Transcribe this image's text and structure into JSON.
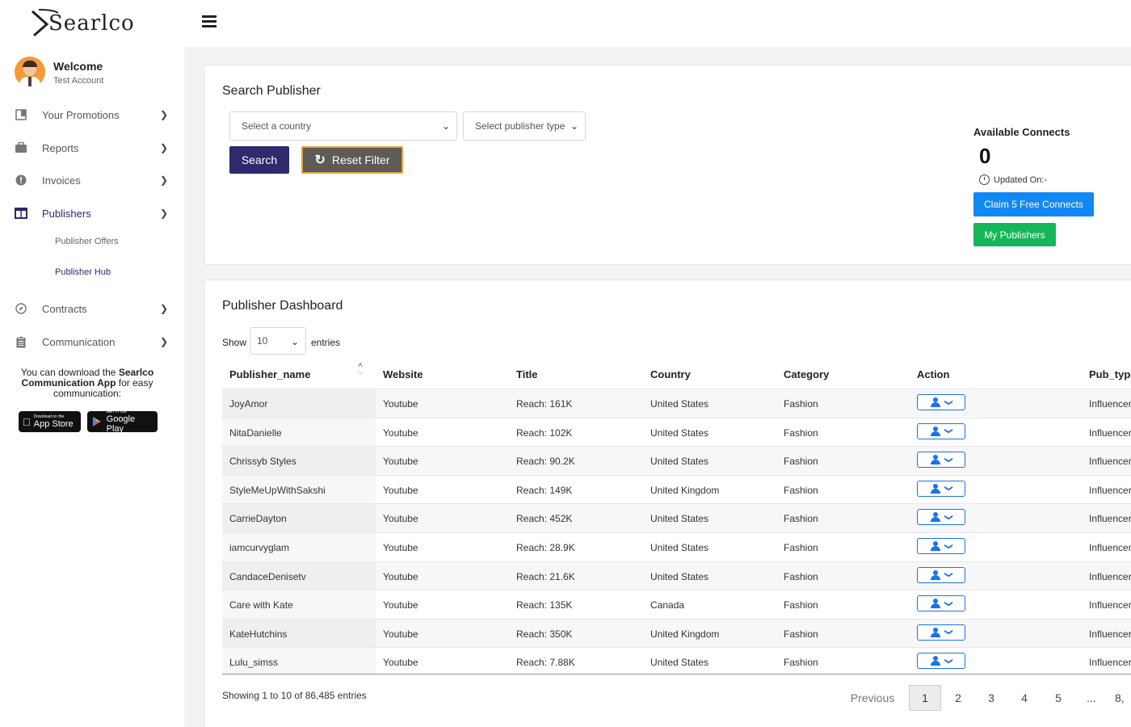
{
  "app": {
    "logo_text": "Searlco"
  },
  "profile": {
    "welcome": "Welcome",
    "account": "Test Account"
  },
  "sidebar": {
    "items": [
      {
        "label": "Your Promotions",
        "icon": "promotions-icon"
      },
      {
        "label": "Reports",
        "icon": "briefcase-icon"
      },
      {
        "label": "Invoices",
        "icon": "alert-circle-icon"
      },
      {
        "label": "Publishers",
        "icon": "columns-icon"
      },
      {
        "label": "Contracts",
        "icon": "compass-icon"
      },
      {
        "label": "Communication",
        "icon": "clipboard-icon"
      }
    ],
    "sub_items": [
      {
        "label": "Publisher Offers"
      },
      {
        "label": "Publisher Hub"
      }
    ],
    "download_pre": "You can download the ",
    "download_bold": "Searlco Communication App",
    "download_post": " for easy communication:",
    "app_store": {
      "small": "Download on the",
      "big": "App Store"
    },
    "google_play": {
      "small": "GET IT ON",
      "big": "Google Play"
    }
  },
  "search": {
    "title": "Search Publisher",
    "country_placeholder": "Select a country",
    "type_placeholder": "Select publisher type",
    "search_label": "Search",
    "reset_label": "Reset Filter"
  },
  "connects": {
    "title": "Available Connects",
    "count": "0",
    "updated": "Updated On:-",
    "claim_label": "Claim 5 Free Connects",
    "my_publishers_label": "My Publishers"
  },
  "dashboard": {
    "title": "Publisher Dashboard",
    "show": "Show",
    "entries_value": "10",
    "entries": "entries",
    "columns": [
      "Publisher_name",
      "Website",
      "Title",
      "Country",
      "Category",
      "Action",
      "Pub_type"
    ],
    "rows": [
      {
        "name": "JoyAmor",
        "website": "Youtube",
        "title": "Reach: 161K",
        "country": "United States",
        "category": "Fashion",
        "pub_type": "Influencer"
      },
      {
        "name": "NitaDanielle",
        "website": "Youtube",
        "title": "Reach: 102K",
        "country": "United States",
        "category": "Fashion",
        "pub_type": "Influencer"
      },
      {
        "name": "Chrissyb Styles",
        "website": "Youtube",
        "title": "Reach: 90.2K",
        "country": "United States",
        "category": "Fashion",
        "pub_type": "Influencer"
      },
      {
        "name": "StyleMeUpWithSakshi",
        "website": "Youtube",
        "title": "Reach: 149K",
        "country": "United Kingdom",
        "category": "Fashion",
        "pub_type": "Influencer"
      },
      {
        "name": "CarrieDayton",
        "website": "Youtube",
        "title": "Reach: 452K",
        "country": "United States",
        "category": "Fashion",
        "pub_type": "Influencer"
      },
      {
        "name": "iamcurvyglam",
        "website": "Youtube",
        "title": "Reach: 28.9K",
        "country": "United States",
        "category": "Fashion",
        "pub_type": "Influencer"
      },
      {
        "name": "CandaceDenisetv",
        "website": "Youtube",
        "title": "Reach: 21.6K",
        "country": "United States",
        "category": "Fashion",
        "pub_type": "Influencer"
      },
      {
        "name": "Care with Kate",
        "website": "Youtube",
        "title": "Reach: 135K",
        "country": "Canada",
        "category": "Fashion",
        "pub_type": "Influencer"
      },
      {
        "name": "KateHutchins",
        "website": "Youtube",
        "title": "Reach: 350K",
        "country": "United Kingdom",
        "category": "Fashion",
        "pub_type": "Influencer"
      },
      {
        "name": "Lulu_simss",
        "website": "Youtube",
        "title": "Reach: 7.88K",
        "country": "United States",
        "category": "Fashion",
        "pub_type": "Influencer"
      }
    ],
    "info": "Showing 1 to 10 of 86,485 entries",
    "pagination": {
      "previous": "Previous",
      "pages": [
        "1",
        "2",
        "3",
        "4",
        "5",
        "...",
        "8,"
      ]
    }
  }
}
